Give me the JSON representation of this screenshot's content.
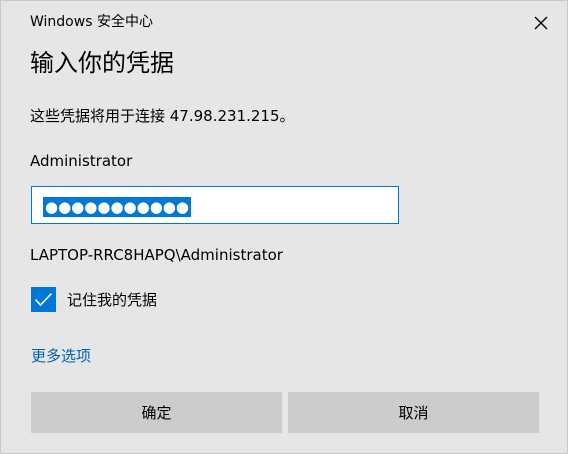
{
  "window": {
    "title": "Windows 安全中心",
    "close_icon": "close-icon"
  },
  "dialog": {
    "heading": "输入你的凭据",
    "description": "这些凭据将用于连接 47.98.231.215。",
    "username": "Administrator",
    "password_masked": "●●●●●●●●●●●",
    "account": "LAPTOP-RRC8HAPQ\\Administrator",
    "remember": {
      "label": "记住我的凭据",
      "checked": true
    },
    "more_options": "更多选项",
    "ok_label": "确定",
    "cancel_label": "取消"
  },
  "colors": {
    "accent": "#0078d7",
    "link": "#0063b1",
    "background": "#e6e6e6",
    "button": "#cccccc"
  }
}
